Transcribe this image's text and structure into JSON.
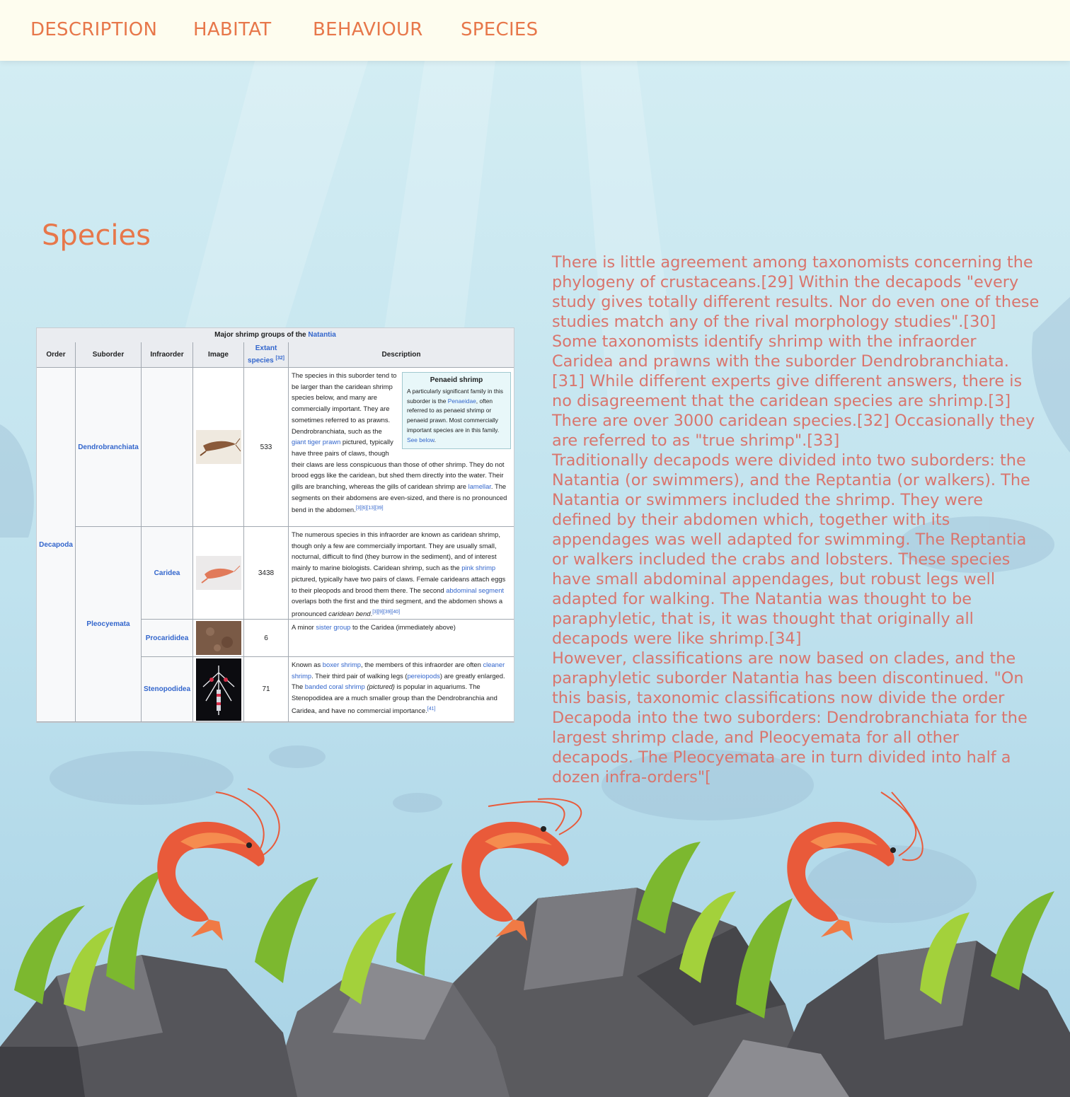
{
  "nav": {
    "items": [
      "DESCRIPTION",
      "HABITAT",
      "BEHAVIOUR",
      "SPECIES"
    ]
  },
  "section": {
    "title": "Species"
  },
  "article": {
    "paragraphs": [
      "There is little agreement among taxonomists concerning the phylogeny of crustaceans.[29] Within the decapods \"every study gives totally different results. Nor do even one of these studies match any of the rival morphology studies\".[30] Some taxonomists identify shrimp with the infraorder Caridea and prawns with the suborder Dendrobranchiata.[31] While different experts give different answers, there is no disagreement that the caridean species are shrimp.[3] There are over 3000 caridean species.[32] Occasionally they are referred to as \"true shrimp\".[33]",
      "Traditionally decapods were divided into two suborders: the Natantia (or swimmers), and the Reptantia (or walkers). The Natantia or swimmers included the shrimp. They were defined by their abdomen which, together with its appendages was well adapted for swimming. The Reptantia or walkers included the crabs and lobsters. These species have small abdominal appendages, but robust legs well adapted for walking. The Natantia was thought to be paraphyletic, that is, it was thought that originally all decapods were like shrimp.[34]",
      "However, classifications are now based on clades, and the paraphyletic suborder Natantia has been discontinued. \"On this basis, taxonomic classifications now divide the order Decapoda into the two suborders: Dendrobranchiata for the largest shrimp clade, and Pleocyemata for all other decapods. The Pleocyemata are in turn divided into half a dozen infra-orders\"["
    ]
  },
  "table": {
    "caption_text": "Major shrimp groups of the ",
    "caption_link": "Natantia",
    "headers": {
      "order": "Order",
      "suborder": "Suborder",
      "infraorder": "Infraorder",
      "image": "Image",
      "extant": "Extant species",
      "extant_ref": "[32]",
      "description": "Description"
    },
    "order": "Decapoda",
    "suborders": [
      "Dendrobranchiata",
      "Pleocyemata"
    ],
    "infraorders": [
      "Caridea",
      "Procarididea",
      "Stenopodidea"
    ],
    "counts": [
      "533",
      "3438",
      "6",
      "71"
    ],
    "infobox": {
      "title": "Penaeid shrimp",
      "t1": "A particularly significant family in this suborder is the ",
      "l1": "Penaeidae",
      "t2": ", often referred to as penaeid shrimp or penaeid prawn. Most commercially important species are in this family. ",
      "l2": "See below",
      "t3": "."
    },
    "desc_dendro": {
      "t1": "The species in this suborder tend to be larger than the caridean shrimp species below, and many are commercially important. They are sometimes referred to as prawns. Dendrobranchiata, such as the ",
      "l1": "giant tiger prawn",
      "t2": " pictured, typically have three pairs of claws, though their claws are less conspicuous than those of other shrimp. They do not brood eggs like the caridean, but shed them directly into the water. Their gills are branching, whereas the gills of caridean shrimp are ",
      "l2": "lamellar",
      "t3": ". The segments on their abdomens are even-sized, and there is no pronounced bend in the abdomen.",
      "ref": "[3][6][13][39]"
    },
    "desc_caridea": {
      "t1": "The numerous species in this infraorder are known as caridean shrimp, though only a few are commercially important. They are usually small, nocturnal, difficult to find (they burrow in the sediment), and of interest mainly to marine biologists. Caridean shrimp, such as the ",
      "l1": "pink shrimp",
      "t2": " pictured, typically have two pairs of claws. Female carideans attach eggs to their pleopods and brood them there. The second ",
      "l2": "abdominal segment",
      "t3": " overlaps both the first and the third segment, and the abdomen shows a pronounced ",
      "em": "caridean bend",
      "t4": ".",
      "ref": "[3][9][39][40]"
    },
    "desc_procarid": {
      "t1": "A minor ",
      "l1": "sister group",
      "t2": " to the Caridea (immediately above)"
    },
    "desc_steno": {
      "t1": "Known as ",
      "l1": "boxer shrimp",
      "t2": ", the members of this infraorder are often ",
      "l2": "cleaner shrimp",
      "t3": ". Their third pair of walking legs (",
      "l3": "pereiopods",
      "t4": ") are greatly enlarged. The ",
      "l4": "banded coral shrimp",
      "em": " (pictured)",
      "t5": " is popular in aquariums. The Stenopodidea are a much smaller group than the Dendrobranchia and Caridea, and have no commercial importance.",
      "ref": "[41]"
    }
  },
  "colors": {
    "accent": "#e7774a",
    "body_text": "#d9756d",
    "link": "#3366cc",
    "nav_bg": "#fefdef"
  }
}
